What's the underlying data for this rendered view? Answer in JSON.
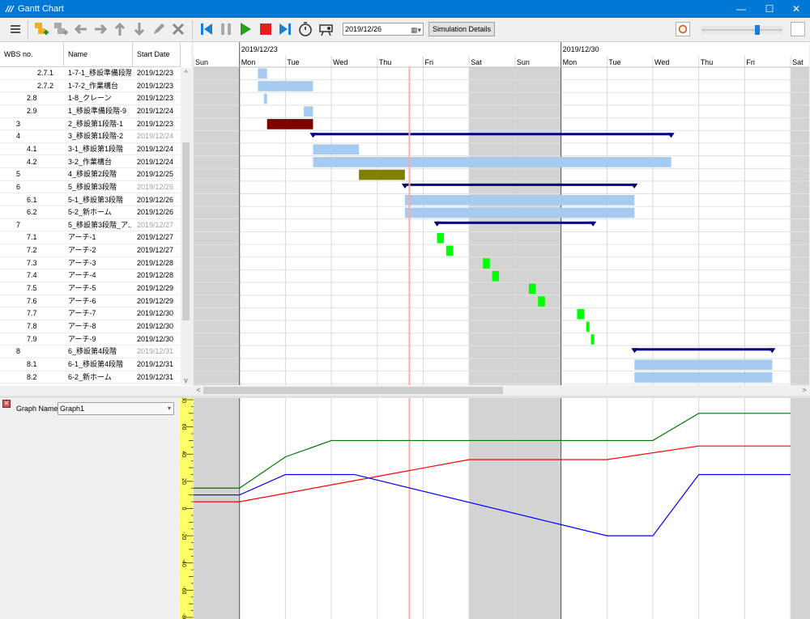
{
  "window": {
    "title": "Gantt Chart",
    "minimize": "—",
    "maximize": "☐",
    "close": "✕"
  },
  "toolbar": {
    "date_value": "2019/12/26",
    "simulation_button": "Simulation Details",
    "buttons": [
      "menu-icon",
      "add-task-icon",
      "add-subtask-icon",
      "arrow-left-icon",
      "arrow-right-icon",
      "arrow-up-icon",
      "arrow-down-icon",
      "pencil-icon",
      "delete-icon",
      "skip-start-icon",
      "pause-icon",
      "play-icon",
      "stop-icon",
      "skip-end-icon",
      "stopwatch-icon",
      "projector-icon"
    ],
    "slider_level": 0.7
  },
  "grid": {
    "headers": {
      "wbs": "WBS no.",
      "name": "Name",
      "start": "Start Date"
    },
    "rows": [
      {
        "wbs": "2.7.1",
        "name": "1-7-1_移設準備段階",
        "start": "2019/12/23",
        "level": 3,
        "summary": false
      },
      {
        "wbs": "2.7.2",
        "name": "1-7-2_作業構台",
        "start": "2019/12/23",
        "level": 3,
        "summary": false
      },
      {
        "wbs": "2.8",
        "name": "1-8_クレーン",
        "start": "2019/12/23",
        "level": 2,
        "summary": false
      },
      {
        "wbs": "2.9",
        "name": "1_移設準備段階-9",
        "start": "2019/12/24",
        "level": 2,
        "summary": false
      },
      {
        "wbs": "3",
        "name": "2_移設第1段階-1",
        "start": "2019/12/23",
        "level": 1,
        "summary": false
      },
      {
        "wbs": "4",
        "name": "3_移設第1段階-2",
        "start": "2019/12/24",
        "level": 1,
        "summary": true
      },
      {
        "wbs": "4.1",
        "name": "3-1_移設第1段階",
        "start": "2019/12/24",
        "level": 2,
        "summary": false
      },
      {
        "wbs": "4.2",
        "name": "3-2_作業構台",
        "start": "2019/12/24",
        "level": 2,
        "summary": false
      },
      {
        "wbs": "5",
        "name": "4_移設第2段階",
        "start": "2019/12/25",
        "level": 1,
        "summary": false
      },
      {
        "wbs": "6",
        "name": "5_移設第3段階",
        "start": "2019/12/26",
        "level": 1,
        "summary": true
      },
      {
        "wbs": "6.1",
        "name": "5-1_移設第3段階",
        "start": "2019/12/26",
        "level": 2,
        "summary": false
      },
      {
        "wbs": "6.2",
        "name": "5-2_新ホーム",
        "start": "2019/12/26",
        "level": 2,
        "summary": false
      },
      {
        "wbs": "7",
        "name": "5_移設第3段階_ア...",
        "start": "2019/12/27",
        "level": 1,
        "summary": true
      },
      {
        "wbs": "7.1",
        "name": "アーチ-1",
        "start": "2019/12/27",
        "level": 2,
        "summary": false
      },
      {
        "wbs": "7.2",
        "name": "アーチ-2",
        "start": "2019/12/27",
        "level": 2,
        "summary": false
      },
      {
        "wbs": "7.3",
        "name": "アーチ-3",
        "start": "2019/12/28",
        "level": 2,
        "summary": false
      },
      {
        "wbs": "7.4",
        "name": "アーチ-4",
        "start": "2019/12/28",
        "level": 2,
        "summary": false
      },
      {
        "wbs": "7.5",
        "name": "アーチ-5",
        "start": "2019/12/29",
        "level": 2,
        "summary": false
      },
      {
        "wbs": "7.6",
        "name": "アーチ-6",
        "start": "2019/12/29",
        "level": 2,
        "summary": false
      },
      {
        "wbs": "7.7",
        "name": "アーチ-7",
        "start": "2019/12/30",
        "level": 2,
        "summary": false
      },
      {
        "wbs": "7.8",
        "name": "アーチ-8",
        "start": "2019/12/30",
        "level": 2,
        "summary": false
      },
      {
        "wbs": "7.9",
        "name": "アーチ-9",
        "start": "2019/12/30",
        "level": 2,
        "summary": false
      },
      {
        "wbs": "8",
        "name": "6_移設第4段階",
        "start": "2019/12/31",
        "level": 1,
        "summary": true
      },
      {
        "wbs": "8.1",
        "name": "6-1_移設第4段階",
        "start": "2019/12/31",
        "level": 2,
        "summary": false
      },
      {
        "wbs": "8.2",
        "name": "6-2_新ホーム",
        "start": "2019/12/31",
        "level": 2,
        "summary": false
      }
    ]
  },
  "gantt": {
    "week_labels": [
      {
        "label": "2019/12/23",
        "day_index": 1
      },
      {
        "label": "2019/12/30",
        "day_index": 8
      }
    ],
    "days": [
      "Sun",
      "Mon",
      "Tue",
      "Wed",
      "Thu",
      "Fri",
      "Sat",
      "Sun",
      "Mon",
      "Tue",
      "Wed",
      "Thu",
      "Fri",
      "Sat"
    ],
    "weekend_day_indexes": [
      0,
      6,
      7,
      13
    ],
    "current_time_day": 4.7,
    "colors": {
      "bar": "#a6caf0",
      "summary": "#00007f",
      "dark_red": "#800000",
      "olive": "#808000",
      "green": "#00ff00",
      "weekend": "#d3d3d3",
      "today_line": "#ffaaaa"
    },
    "tasks": [
      {
        "row": 0,
        "start": 1.4,
        "end": 1.6,
        "kind": "bar"
      },
      {
        "row": 1,
        "start": 1.4,
        "end": 2.6,
        "kind": "bar"
      },
      {
        "row": 2,
        "start": 1.53,
        "end": 1.6,
        "kind": "bar"
      },
      {
        "row": 3,
        "start": 2.4,
        "end": 2.6,
        "kind": "bar"
      },
      {
        "row": 4,
        "start": 1.6,
        "end": 2.6,
        "kind": "dark_red"
      },
      {
        "row": 5,
        "start": 2.6,
        "end": 10.4,
        "kind": "summary"
      },
      {
        "row": 6,
        "start": 2.6,
        "end": 3.6,
        "kind": "bar"
      },
      {
        "row": 7,
        "start": 2.6,
        "end": 10.4,
        "kind": "bar"
      },
      {
        "row": 8,
        "start": 3.6,
        "end": 4.6,
        "kind": "olive"
      },
      {
        "row": 9,
        "start": 4.6,
        "end": 9.6,
        "kind": "summary"
      },
      {
        "row": 10,
        "start": 4.6,
        "end": 9.6,
        "kind": "bar"
      },
      {
        "row": 11,
        "start": 4.6,
        "end": 9.6,
        "kind": "bar"
      },
      {
        "row": 12,
        "start": 5.3,
        "end": 8.7,
        "kind": "summary"
      },
      {
        "row": 13,
        "start": 5.3,
        "end": 5.45,
        "kind": "green"
      },
      {
        "row": 14,
        "start": 5.5,
        "end": 5.65,
        "kind": "green"
      },
      {
        "row": 15,
        "start": 6.3,
        "end": 6.45,
        "kind": "green"
      },
      {
        "row": 16,
        "start": 6.5,
        "end": 6.65,
        "kind": "green"
      },
      {
        "row": 17,
        "start": 7.3,
        "end": 7.45,
        "kind": "green"
      },
      {
        "row": 18,
        "start": 7.5,
        "end": 7.65,
        "kind": "green"
      },
      {
        "row": 19,
        "start": 8.35,
        "end": 8.5,
        "kind": "green"
      },
      {
        "row": 20,
        "start": 8.55,
        "end": 8.62,
        "kind": "green"
      },
      {
        "row": 21,
        "start": 8.65,
        "end": 8.72,
        "kind": "green"
      },
      {
        "row": 22,
        "start": 9.6,
        "end": 12.6,
        "kind": "summary"
      },
      {
        "row": 23,
        "start": 9.6,
        "end": 12.6,
        "kind": "bar"
      },
      {
        "row": 24,
        "start": 9.6,
        "end": 12.6,
        "kind": "bar"
      }
    ]
  },
  "graph": {
    "name_label": "Graph Name :",
    "selected": "Graph1",
    "close_icon": "close-icon"
  },
  "chart_data": {
    "type": "line",
    "x_unit": "day",
    "ylim": [
      -80,
      80
    ],
    "y_ticks": [
      -80,
      -60,
      -40,
      -20,
      0,
      20,
      40,
      60,
      80
    ],
    "series": [
      {
        "color": "#007700",
        "points": [
          [
            0,
            15
          ],
          [
            1,
            15
          ],
          [
            2,
            38
          ],
          [
            3,
            50
          ],
          [
            10,
            50
          ],
          [
            11,
            70
          ],
          [
            13,
            70
          ]
        ]
      },
      {
        "color": "#ff0000",
        "points": [
          [
            0,
            5
          ],
          [
            1,
            5
          ],
          [
            6,
            36
          ],
          [
            9,
            36
          ],
          [
            11,
            46
          ],
          [
            13,
            46
          ]
        ]
      },
      {
        "color": "#0000ff",
        "points": [
          [
            0,
            10
          ],
          [
            1,
            10
          ],
          [
            2,
            25
          ],
          [
            3.5,
            25
          ],
          [
            9,
            -20
          ],
          [
            10,
            -20
          ],
          [
            11,
            25
          ],
          [
            13,
            25
          ]
        ]
      }
    ]
  }
}
